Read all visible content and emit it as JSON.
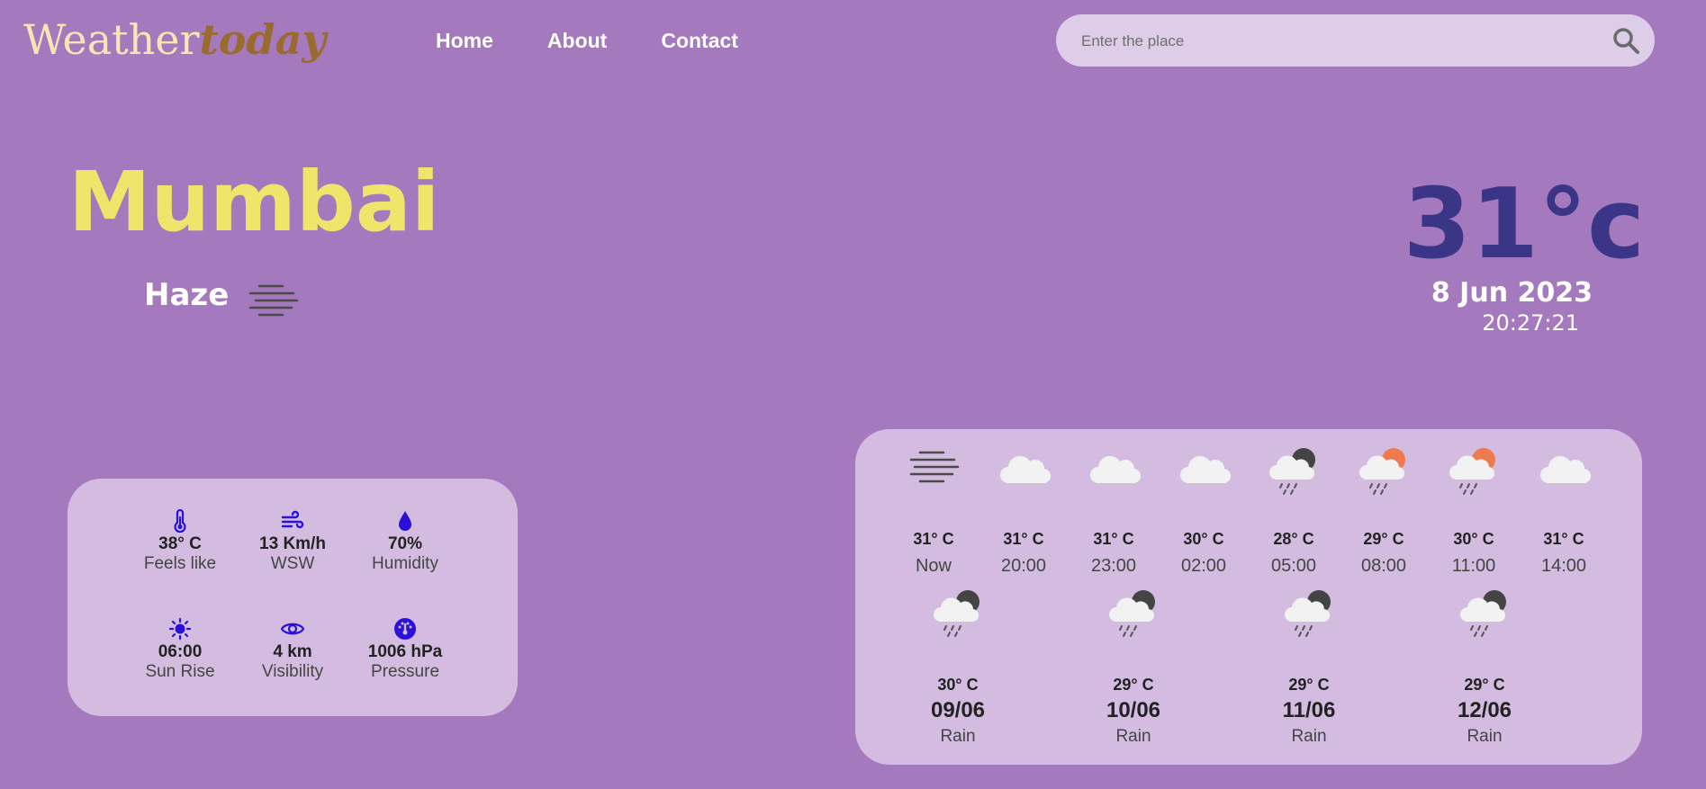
{
  "header": {
    "logo_part1": "Weather",
    "logo_part2": "today",
    "nav": [
      "Home",
      "About",
      "Contact"
    ],
    "search_placeholder": "Enter the place",
    "search_value": ""
  },
  "current": {
    "city": "Mumbai",
    "condition": "Haze",
    "condition_icon": "haze-icon",
    "temperature": "31°c",
    "date": "8 Jun 2023",
    "time": "20:27:21"
  },
  "stats": [
    {
      "icon": "thermometer-icon",
      "value": "38° C",
      "label": "Feels like"
    },
    {
      "icon": "wind-icon",
      "value": "13 Km/h",
      "label": "WSW"
    },
    {
      "icon": "droplet-icon",
      "value": "70%",
      "label": "Humidity"
    },
    {
      "icon": "sun-icon",
      "value": "06:00",
      "label": "Sun Rise"
    },
    {
      "icon": "eye-icon",
      "value": "4 km",
      "label": "Visibility"
    },
    {
      "icon": "gauge-icon",
      "value": "1006 hPa",
      "label": "Pressure"
    }
  ],
  "hourly": [
    {
      "icon": "haze-icon",
      "temp": "31° C",
      "time": "Now"
    },
    {
      "icon": "cloud-icon",
      "temp": "31° C",
      "time": "20:00"
    },
    {
      "icon": "cloud-icon",
      "temp": "31° C",
      "time": "23:00"
    },
    {
      "icon": "cloud-icon",
      "temp": "30° C",
      "time": "02:00"
    },
    {
      "icon": "night-rain-icon",
      "temp": "28° C",
      "time": "05:00"
    },
    {
      "icon": "day-rain-icon",
      "temp": "29° C",
      "time": "08:00"
    },
    {
      "icon": "day-rain-icon",
      "temp": "30° C",
      "time": "11:00"
    },
    {
      "icon": "cloud-icon",
      "temp": "31° C",
      "time": "14:00"
    }
  ],
  "daily": [
    {
      "icon": "night-rain-icon",
      "temp": "30° C",
      "date": "09/06",
      "cond": "Rain"
    },
    {
      "icon": "night-rain-icon",
      "temp": "29° C",
      "date": "10/06",
      "cond": "Rain"
    },
    {
      "icon": "night-rain-icon",
      "temp": "29° C",
      "date": "11/06",
      "cond": "Rain"
    },
    {
      "icon": "night-rain-icon",
      "temp": "29° C",
      "date": "12/06",
      "cond": "Rain"
    }
  ],
  "colors": {
    "background": "#a479bd",
    "panel": "#d3bce0",
    "city": "#efe56a",
    "temperature": "#3a3586",
    "stat_icon": "#2a10d8",
    "logo_light": "#f6e6b6",
    "logo_dark": "#9a6b2e"
  }
}
